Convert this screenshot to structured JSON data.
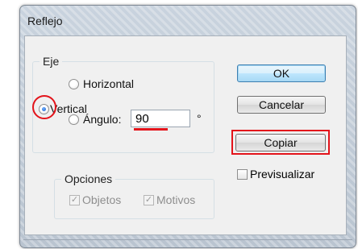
{
  "dialog": {
    "title": "Reflejo",
    "eje": {
      "legend": "Eje",
      "horizontal": "Horizontal",
      "vertical": "Vertical",
      "angle_label": "Ángulo:",
      "angle_value": "90",
      "degree_symbol": "°",
      "selected": "vertical"
    },
    "opciones": {
      "legend": "Opciones",
      "objetos": "Objetos",
      "motivos": "Motivos",
      "objetos_checked": true,
      "motivos_checked": true
    },
    "buttons": {
      "ok": "OK",
      "cancel": "Cancelar",
      "copy": "Copiar"
    },
    "preview": {
      "label": "Previsualizar",
      "checked": false
    },
    "check_glyph": "✓"
  },
  "colors": {
    "annotation": "#e3141b",
    "default_button_border": "#3c7fb1"
  }
}
